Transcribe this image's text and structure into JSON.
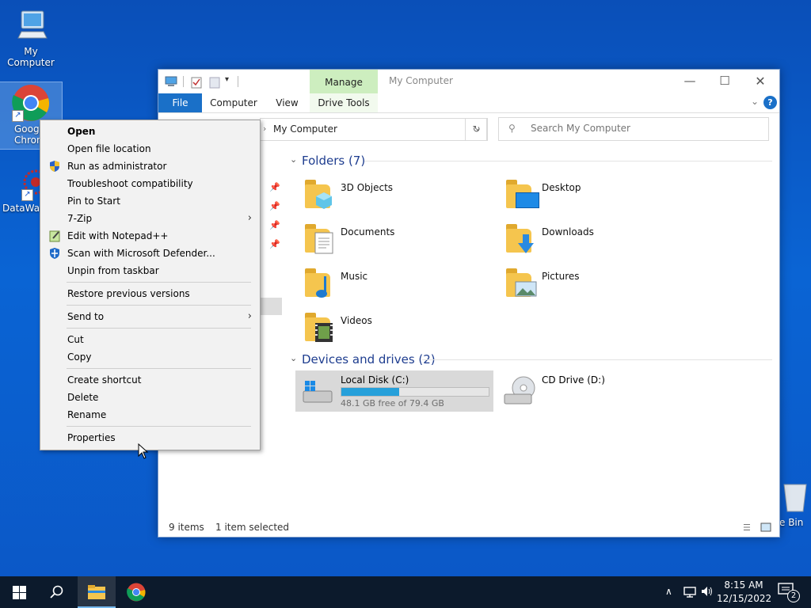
{
  "desktop": {
    "icons": [
      {
        "label": "My Computer"
      },
      {
        "label": "Google Chrome",
        "label_visible": "Googl Chron"
      },
      {
        "label": "DataWag"
      }
    ],
    "recycle_label": "e Bin"
  },
  "explorer": {
    "title": "My Computer",
    "manage_tab": "Manage",
    "tabs": [
      "File",
      "Computer",
      "View",
      "Drive Tools"
    ],
    "address": "My Computer",
    "search_placeholder": "Search My Computer",
    "folders_header": "Folders (7)",
    "folders": [
      {
        "name": "3D Objects"
      },
      {
        "name": "Desktop"
      },
      {
        "name": "Documents"
      },
      {
        "name": "Downloads"
      },
      {
        "name": "Music"
      },
      {
        "name": "Pictures"
      },
      {
        "name": "Videos"
      }
    ],
    "drives_header": "Devices and drives (2)",
    "drives": [
      {
        "name": "Local Disk (C:)",
        "free": "48.1 GB free of 79.4 GB",
        "used_fraction": 0.39
      },
      {
        "name": "CD Drive (D:)"
      }
    ],
    "status": {
      "items": "9 items",
      "selected": "1 item selected"
    }
  },
  "context_menu": {
    "items": [
      "Open",
      "Open file location",
      "Run as administrator",
      "Troubleshoot compatibility",
      "Pin to Start",
      "7-Zip",
      "Edit with Notepad++",
      "Scan with Microsoft Defender...",
      "Unpin from taskbar",
      "Restore previous versions",
      "Send to",
      "Cut",
      "Copy",
      "Create shortcut",
      "Delete",
      "Rename",
      "Properties"
    ]
  },
  "taskbar": {
    "time": "8:15 AM",
    "date": "12/15/2022",
    "notification_count": "2"
  },
  "colors": {
    "accent": "#1a70c8",
    "manage_tab": "#cdeebf",
    "drive_fill": "#26a0da"
  }
}
